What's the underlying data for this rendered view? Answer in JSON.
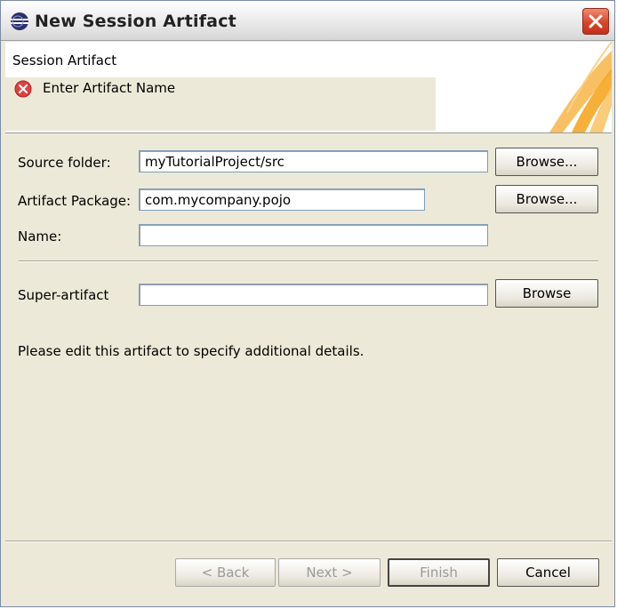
{
  "window": {
    "title": "New Session Artifact"
  },
  "header": {
    "title": "Session Artifact",
    "message": "Enter Artifact Name"
  },
  "form": {
    "source_folder": {
      "label": "Source folder:",
      "value": "myTutorialProject/src",
      "browse": "Browse..."
    },
    "artifact_package": {
      "label": "Artifact Package:",
      "value": "com.mycompany.pojo",
      "browse": "Browse..."
    },
    "name": {
      "label": "Name:",
      "value": ""
    },
    "super_artifact": {
      "label": "Super-artifact",
      "value": "",
      "browse": "Browse"
    },
    "note": "Please edit this artifact to specify additional details."
  },
  "buttons": {
    "back": "< Back",
    "next": "Next >",
    "finish": "Finish",
    "cancel": "Cancel"
  },
  "colors": {
    "error": "#e04040",
    "banner_accent": "#f5a623"
  }
}
